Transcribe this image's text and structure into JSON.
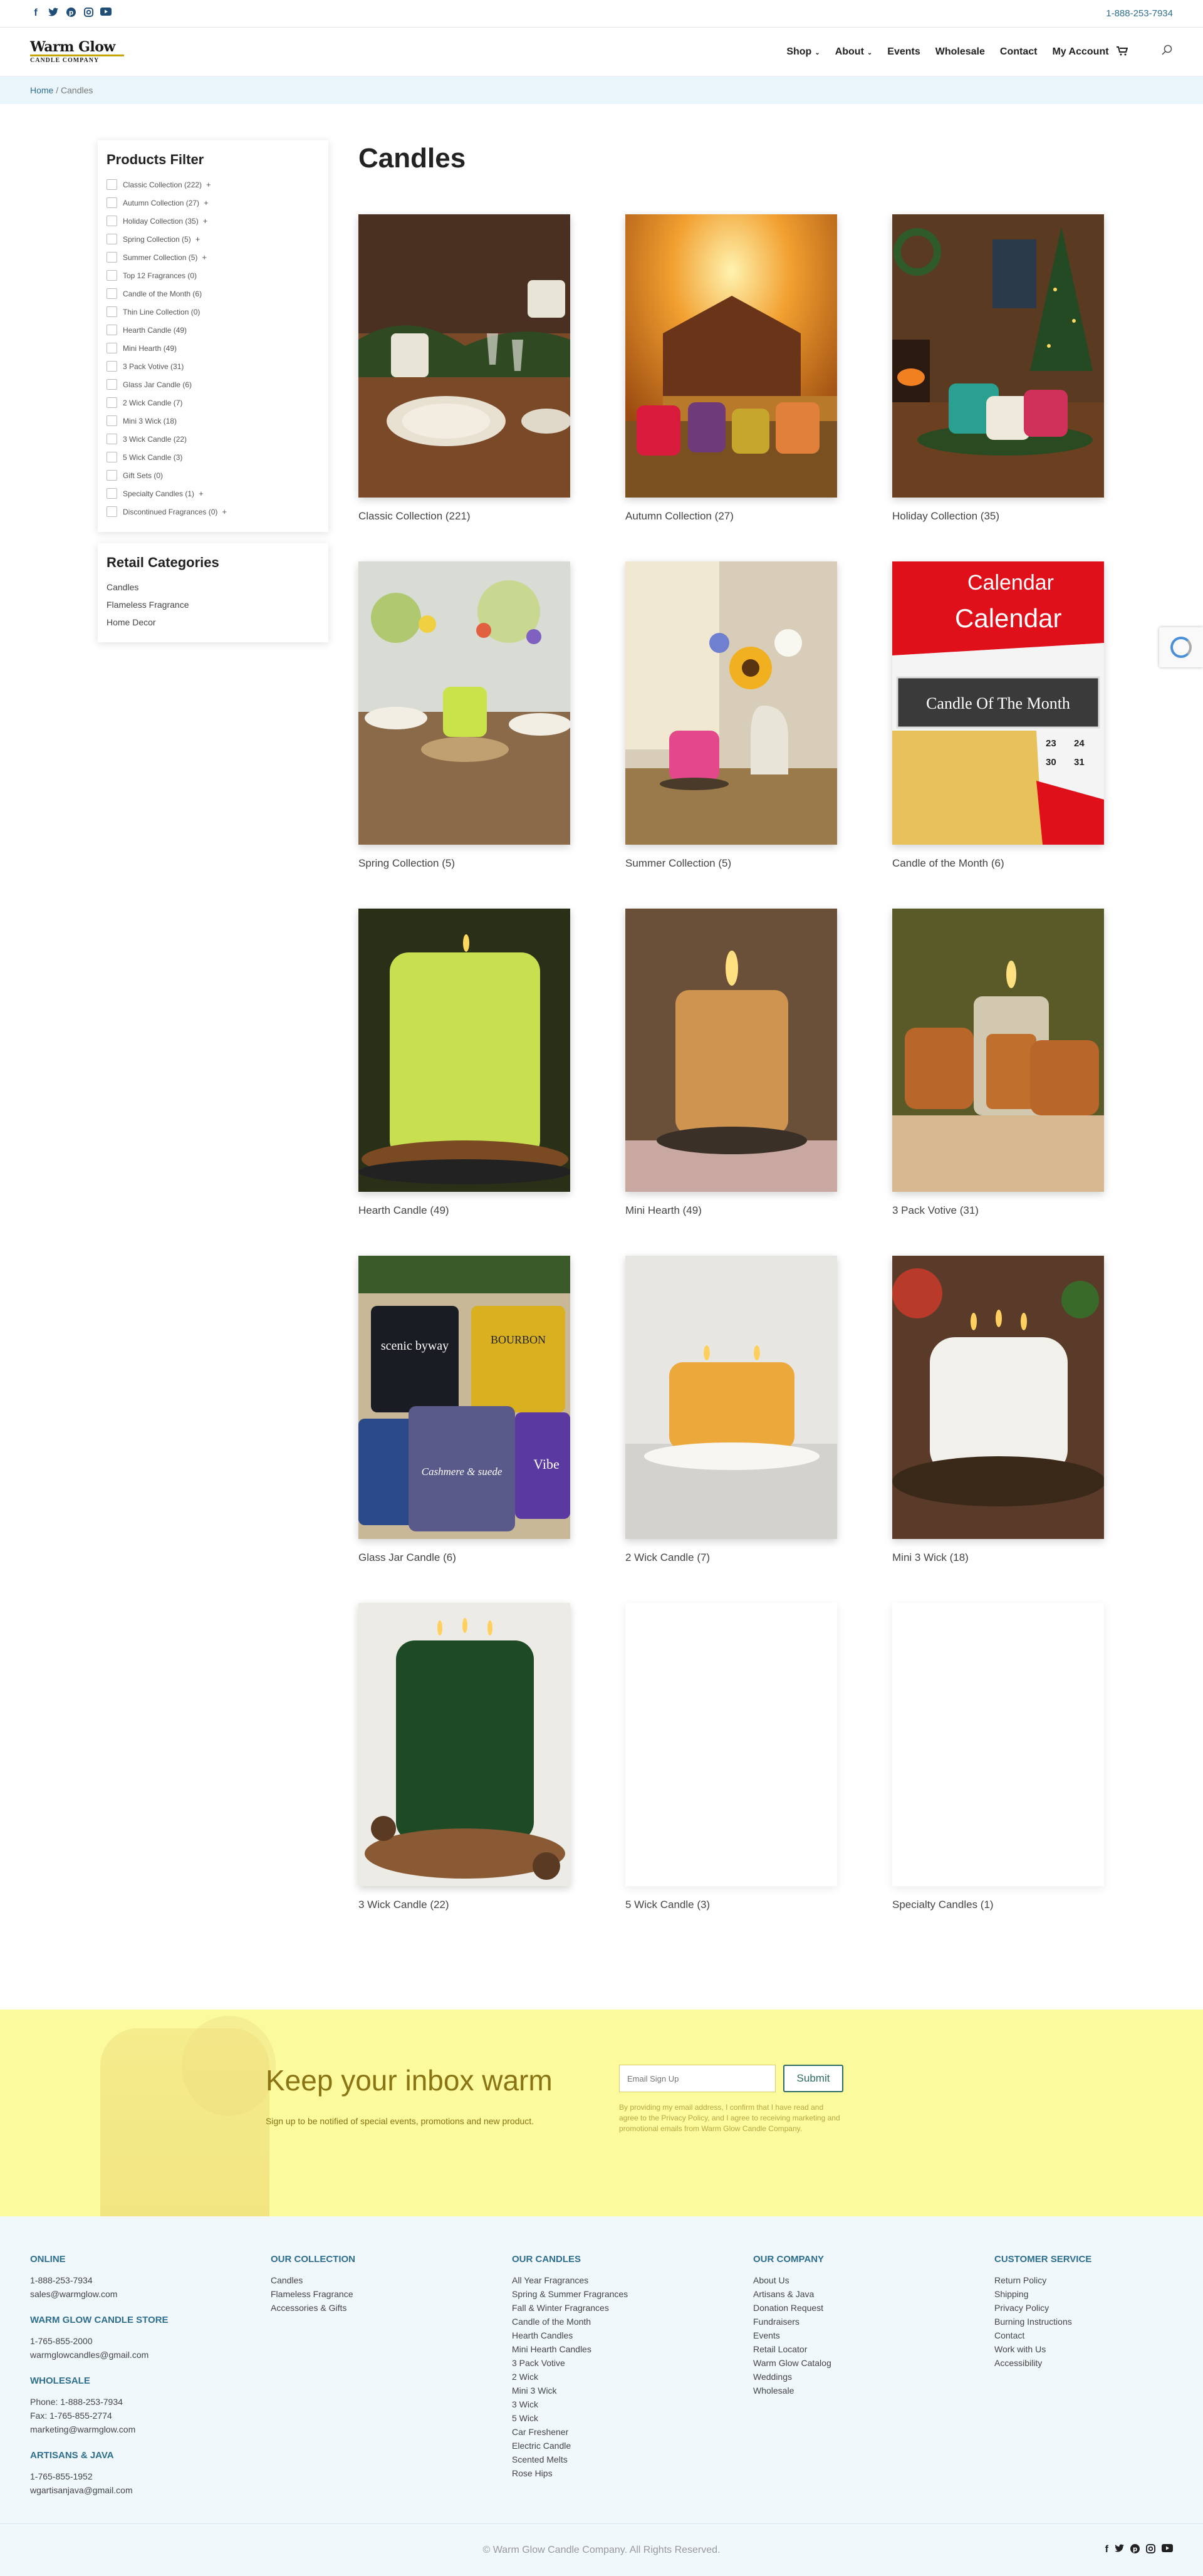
{
  "topbar": {
    "phone": "1-888-253-7934",
    "social_icons": [
      "facebook-icon",
      "twitter-icon",
      "pinterest-icon",
      "instagram-icon",
      "youtube-icon"
    ]
  },
  "header": {
    "logo_line1": "Warm Glow",
    "logo_line2": "CANDLE COMPANY",
    "nav": {
      "shop": "Shop",
      "about": "About",
      "events": "Events",
      "wholesale": "Wholesale",
      "contact": "Contact",
      "account": "My Account"
    }
  },
  "breadcrumb": {
    "home": "Home",
    "sep": " / ",
    "current": "Candles"
  },
  "filter": {
    "title": "Products Filter",
    "items": [
      {
        "label": "Classic Collection (222)",
        "expand": "+"
      },
      {
        "label": "Autumn Collection (27)",
        "expand": "+"
      },
      {
        "label": "Holiday Collection (35)",
        "expand": "+"
      },
      {
        "label": "Spring Collection (5)",
        "expand": "+"
      },
      {
        "label": "Summer Collection (5)",
        "expand": "+"
      },
      {
        "label": "Top 12 Fragrances (0)",
        "expand": ""
      },
      {
        "label": "Candle of the Month (6)",
        "expand": ""
      },
      {
        "label": "Thin Line Collection (0)",
        "expand": ""
      },
      {
        "label": "Hearth Candle (49)",
        "expand": ""
      },
      {
        "label": "Mini Hearth (49)",
        "expand": ""
      },
      {
        "label": "3 Pack Votive (31)",
        "expand": ""
      },
      {
        "label": "Glass Jar Candle (6)",
        "expand": ""
      },
      {
        "label": "2 Wick Candle (7)",
        "expand": ""
      },
      {
        "label": "Mini 3 Wick (18)",
        "expand": ""
      },
      {
        "label": "3 Wick Candle (22)",
        "expand": ""
      },
      {
        "label": "5 Wick Candle (3)",
        "expand": ""
      },
      {
        "label": "Gift Sets (0)",
        "expand": ""
      },
      {
        "label": "Specialty Candles (1)",
        "expand": "+"
      },
      {
        "label": "Discontinued Fragrances (0)",
        "expand": "+"
      }
    ]
  },
  "retail": {
    "title": "Retail Categories",
    "items": [
      "Candles",
      "Flameless Fragrance",
      "Home Decor"
    ]
  },
  "page_title": "Candles",
  "products": [
    {
      "label": "Classic Collection  (221)"
    },
    {
      "label": "Autumn Collection  (27)"
    },
    {
      "label": "Holiday Collection  (35)"
    },
    {
      "label": "Spring Collection  (5)"
    },
    {
      "label": "Summer Collection  (5)"
    },
    {
      "label": "Candle of the Month  (6)",
      "banner_title": "Calendar",
      "banner_text": "Candle Of  The Month",
      "dates": [
        "23",
        "24",
        "30",
        "31"
      ]
    },
    {
      "label": "Hearth Candle  (49)"
    },
    {
      "label": "Mini Hearth  (49)"
    },
    {
      "label": "3 Pack Votive  (31)"
    },
    {
      "label": "Glass Jar Candle  (6)",
      "jar_labels": [
        "scenic byway",
        "BOURBON",
        "Cashmere & suede",
        "Vibe"
      ]
    },
    {
      "label": "2 Wick Candle  (7)"
    },
    {
      "label": "Mini 3 Wick  (18)"
    },
    {
      "label": "3 Wick Candle  (22)"
    },
    {
      "label": "5 Wick Candle  (3)"
    },
    {
      "label": "Specialty Candles  (1)"
    }
  ],
  "newsletter": {
    "title": "Keep your inbox warm",
    "subtitle": "Sign up to be notified of special events, promotions and new product.",
    "placeholder": "Email Sign Up",
    "submit": "Submit",
    "note": "By providing my email address, I confirm that I have read and agree to the Privacy Policy, and I agree to receiving marketing and promotional emails from Warm Glow Candle Company."
  },
  "footer": {
    "col1": {
      "online": {
        "title": "ONLINE",
        "lines": [
          "1-888-253-7934",
          "sales@warmglow.com"
        ]
      },
      "store": {
        "title": "WARM GLOW CANDLE STORE",
        "lines": [
          "1-765-855-2000",
          "warmglowcandles@gmail.com"
        ]
      },
      "wholesale": {
        "title": "WHOLESALE",
        "lines": [
          "Phone: 1-888-253-7934",
          "Fax: 1-765-855-2774",
          "marketing@warmglow.com"
        ]
      },
      "artisans": {
        "title": "ARTISANS & JAVA",
        "lines": [
          "1-765-855-1952",
          "wgartisanjava@gmail.com"
        ]
      }
    },
    "collection": {
      "title": "OUR COLLECTION",
      "links": [
        "Candles",
        "Flameless Fragrance",
        "Accessories & Gifts"
      ]
    },
    "candles": {
      "title": "OUR CANDLES",
      "links": [
        "All Year Fragrances",
        "Spring & Summer Fragrances",
        "Fall & Winter Fragrances",
        "Candle of the Month",
        "Hearth Candles",
        "Mini Hearth Candles",
        "3 Pack Votive",
        "2 Wick",
        "Mini 3 Wick",
        "3 Wick",
        "5 Wick",
        "Car Freshener",
        "Electric Candle",
        "Scented Melts",
        "Rose Hips"
      ]
    },
    "company": {
      "title": "OUR COMPANY",
      "links": [
        "About Us",
        "Artisans & Java",
        "Donation Request",
        "Fundraisers",
        "Events",
        "Retail Locator",
        "Warm Glow Catalog",
        "Weddings",
        "Wholesale"
      ]
    },
    "service": {
      "title": "CUSTOMER SERVICE",
      "links": [
        "Return Policy",
        "Shipping",
        "Privacy Policy",
        "Burning Instructions",
        "Contact",
        "Work with Us",
        "Accessibility"
      ]
    },
    "copyright": "© Warm Glow Candle Company. All Rights Reserved."
  }
}
